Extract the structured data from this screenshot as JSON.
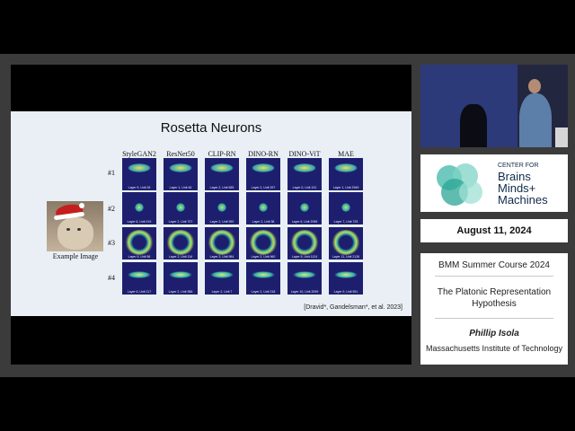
{
  "slide": {
    "title": "Rosetta Neurons",
    "example_label": "Example Image",
    "citation": "[Dravid*, Gandelsman*, et al. 2023]",
    "columns": [
      "StyleGAN2",
      "ResNet50",
      "CLIP-RN",
      "DINO-RN",
      "DINO-ViT",
      "MAE"
    ],
    "rows": [
      {
        "label": "#1",
        "units": [
          "Layer 9, Unit 93",
          "Layer 1, Unit 46",
          "Layer 2, Unit 655",
          "Layer 2, Unit 297",
          "Layer 0, Unit 131",
          "Layer 1, Unit 2949"
        ]
      },
      {
        "label": "#2",
        "units": [
          "Layer 6, Unit 419",
          "Layer 2, Unit 707",
          "Layer 2, Unit 992",
          "Layer 2, Unit 38",
          "Layer 6, Unit 2096",
          "Layer 7, Unit 725"
        ]
      },
      {
        "label": "#3",
        "units": [
          "Layer 9, Unit 56",
          "Layer 2, Unit 116",
          "Layer 2, Unit 984",
          "Layer 2, Unit 960",
          "Layer 5, Unit 1124",
          "Layer 11, Unit 2126"
        ]
      },
      {
        "label": "#4",
        "units": [
          "Layer 6, Unit 117",
          "Layer 2, Unit 986",
          "Layer 2, Unit 7",
          "Layer 2, Unit 218",
          "Layer 10, Unit 2099",
          "Layer 9, Unit 591"
        ]
      }
    ]
  },
  "sidebar": {
    "logo": {
      "line1": "CENTER FOR",
      "line2": "Brains",
      "line3": "Minds+",
      "line4": "Machines"
    },
    "date": "August 11, 2024",
    "course": "BMM Summer Course 2024",
    "talk_title_line1": "The Platonic Representation",
    "talk_title_line2": "Hypothesis",
    "speaker": "Phillip Isola",
    "affiliation": "Massachusetts Institute of Technology"
  },
  "colors": {
    "tile_bg": "#1d1f6e",
    "logo_teal": "#3fb7a8",
    "slide_bg": "#e9eff5"
  }
}
